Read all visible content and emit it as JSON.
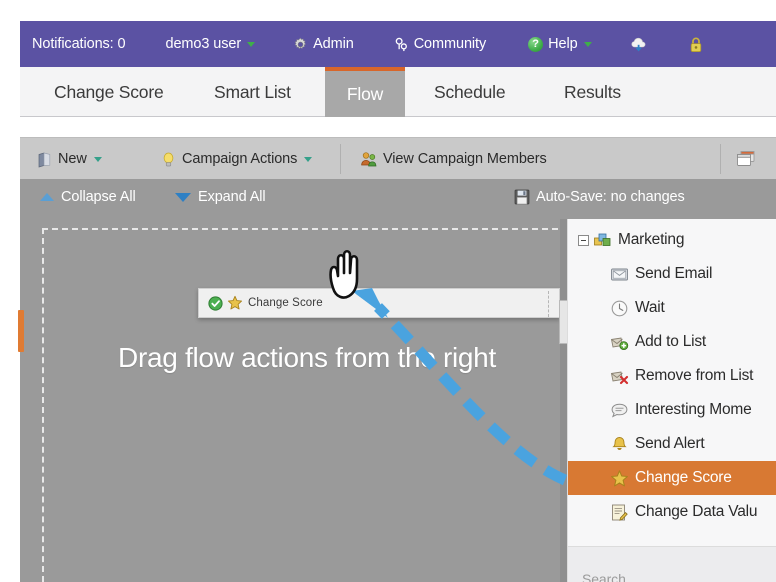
{
  "topnav": {
    "background": "#5b52a3",
    "items": [
      {
        "id": "notifications",
        "label": "Notifications: 0",
        "icon": "",
        "caret": false
      },
      {
        "id": "user",
        "label": "demo3 user",
        "icon": "",
        "caret": true
      },
      {
        "id": "admin",
        "label": "Admin",
        "icon": "gear-icon",
        "caret": false
      },
      {
        "id": "community",
        "label": "Community",
        "icon": "community-icon",
        "caret": false
      },
      {
        "id": "help",
        "label": "Help",
        "icon": "help-icon",
        "caret": true
      },
      {
        "id": "cloud",
        "label": "",
        "icon": "cloud-download-icon",
        "caret": false
      },
      {
        "id": "lock",
        "label": "",
        "icon": "lock-icon",
        "caret": false
      }
    ]
  },
  "tabs": {
    "active_color": "#a8a8a8",
    "active_border": "#d8662a",
    "items": [
      {
        "id": "change-score",
        "label": "Change Score",
        "active": false
      },
      {
        "id": "smart-list",
        "label": "Smart List",
        "active": false
      },
      {
        "id": "flow",
        "label": "Flow",
        "active": true
      },
      {
        "id": "schedule",
        "label": "Schedule",
        "active": false
      },
      {
        "id": "results",
        "label": "Results",
        "active": false
      }
    ]
  },
  "toolbar": {
    "background": "#c9c9c9",
    "new_label": "New",
    "campaign_actions_label": "Campaign Actions",
    "view_members_label": "View Campaign Members",
    "panel_toggle_icon": "window-panel-icon"
  },
  "subbar": {
    "background": "#9a9a9a",
    "collapse_all_label": "Collapse All",
    "expand_all_label": "Expand All",
    "autosave_label": "Auto-Save: no changes",
    "autosave_icon": "floppy-save-icon"
  },
  "canvas": {
    "hint_text": "Drag flow actions from the right",
    "background": "#9a9a9a",
    "dashed_border_color": "#e8e8e8",
    "left_handle_color": "#e07b33"
  },
  "drag_ghost": {
    "label": "Change Score",
    "status_icon": "green-check-icon",
    "type_icon": "gold-star-icon"
  },
  "sidebar": {
    "background": "#f7f7f8",
    "selected_color": "#d87933",
    "tree": [
      {
        "id": "marketing",
        "label": "Marketing",
        "icon": "folder-cubes-icon",
        "level": 0,
        "expandable": true,
        "selected": false
      },
      {
        "id": "send-email",
        "label": "Send Email",
        "icon": "email-icon",
        "level": 1,
        "expandable": false,
        "selected": false
      },
      {
        "id": "wait",
        "label": "Wait",
        "icon": "clock-icon",
        "level": 1,
        "expandable": false,
        "selected": false
      },
      {
        "id": "add-to-list",
        "label": "Add to List",
        "icon": "add-list-icon",
        "level": 1,
        "expandable": false,
        "selected": false
      },
      {
        "id": "remove-from-list",
        "label": "Remove from List",
        "icon": "remove-list-icon",
        "level": 1,
        "expandable": false,
        "selected": false
      },
      {
        "id": "interesting-moment",
        "label": "Interesting Mome",
        "icon": "speech-bubble-icon",
        "level": 1,
        "expandable": false,
        "selected": false
      },
      {
        "id": "send-alert",
        "label": "Send Alert",
        "icon": "bell-icon",
        "level": 1,
        "expandable": false,
        "selected": false
      },
      {
        "id": "change-score",
        "label": "Change Score",
        "icon": "gold-star-icon",
        "level": 1,
        "expandable": false,
        "selected": true
      },
      {
        "id": "change-data-value",
        "label": "Change Data Valu",
        "icon": "edit-form-icon",
        "level": 1,
        "expandable": false,
        "selected": false
      }
    ],
    "search_placeholder": "Search"
  },
  "annotation": {
    "arrow_color": "#4aa3df",
    "cursor_icon": "grab-hand-cursor"
  }
}
